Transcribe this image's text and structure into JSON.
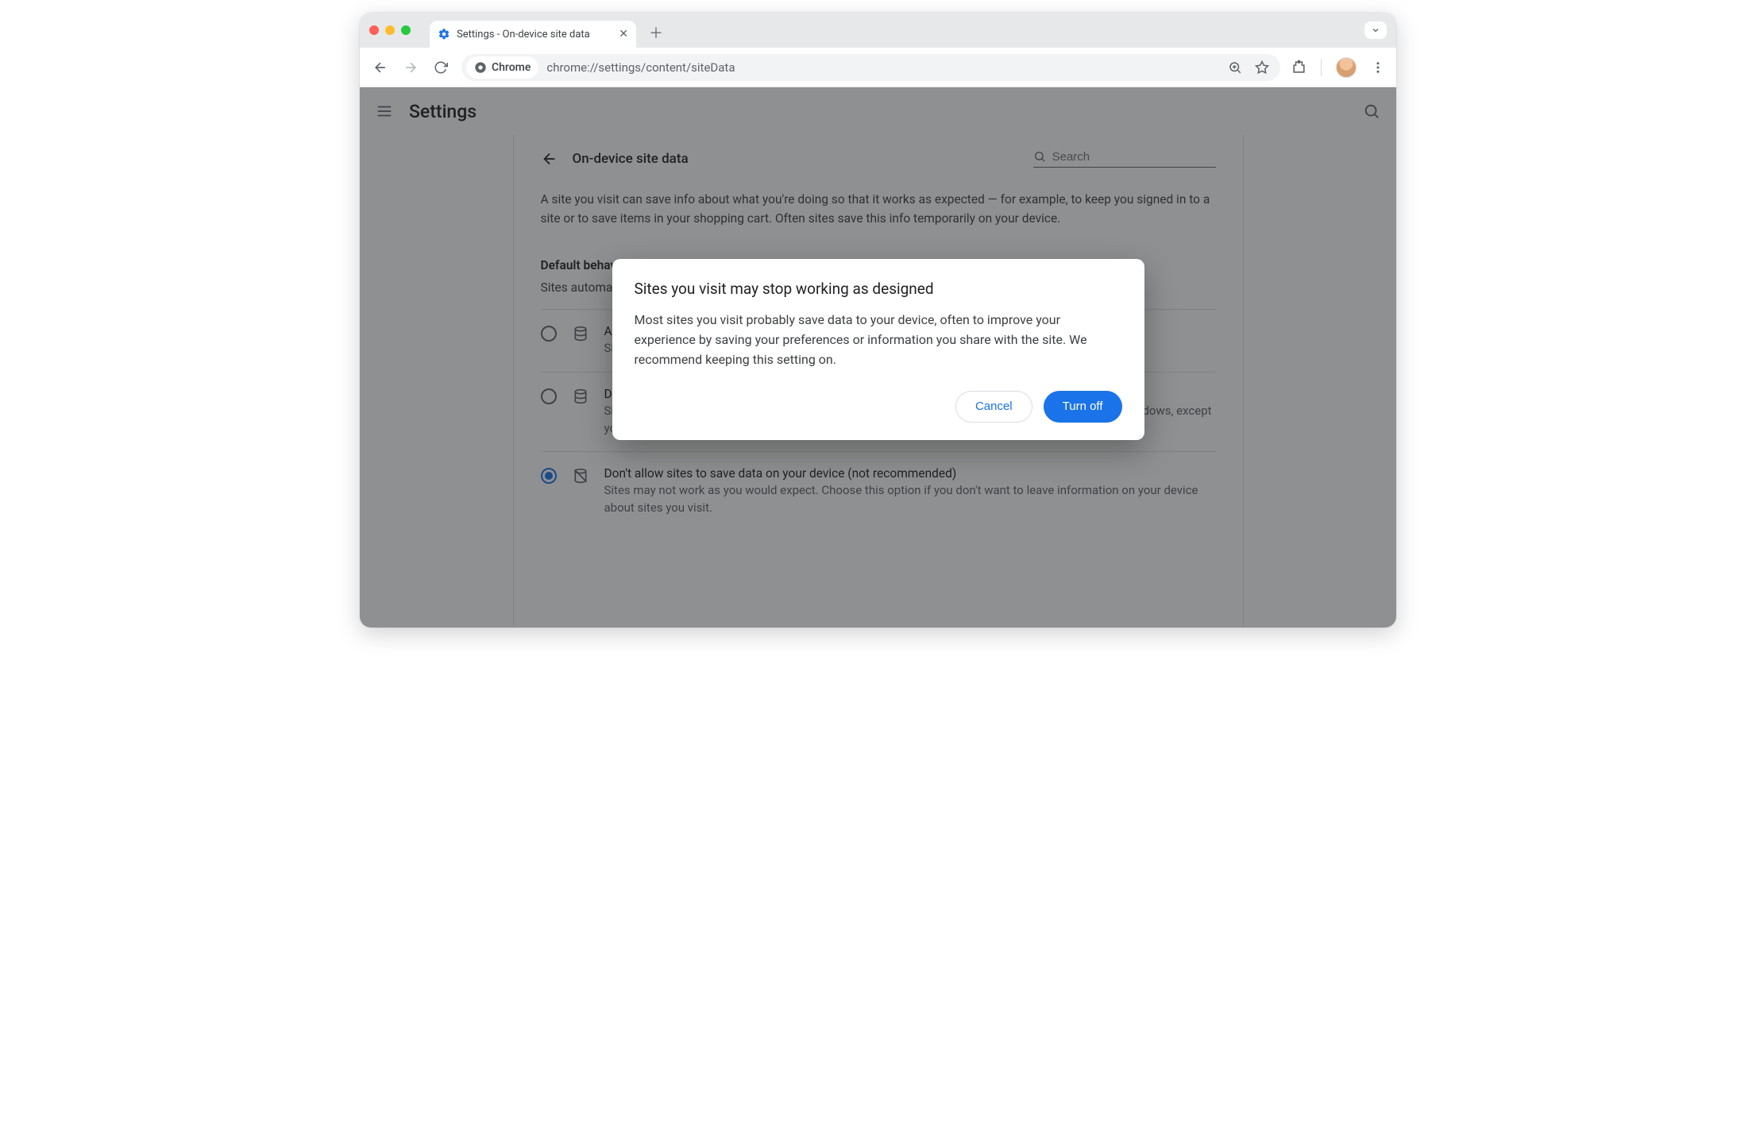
{
  "window": {
    "tab_title": "Settings - On-device site data",
    "url": "chrome://settings/content/siteData",
    "address_chip_label": "Chrome"
  },
  "header": {
    "app_title": "Settings"
  },
  "page": {
    "title": "On-device site data",
    "search_placeholder": "Search",
    "description": "A site you visit can save info about what you're doing so that it works as expected — for example, to keep you signed in to a site or to save items in your shopping cart. Often sites save this info temporarily on your device.",
    "section_heading": "Default behavior",
    "section_subtext": "Sites automatically follow this setting when you visit them",
    "options": [
      {
        "title": "Allow sites to save data on your device (recommended)",
        "subtitle": "Sites will work as expected.",
        "selected": false
      },
      {
        "title": "Delete data sites have saved to your device when you close all windows",
        "subtitle": "Sites will probably work as expected. You'll be signed out of most sites when you close all Chrome windows, except your Google Account if you're signed in to Chrome.",
        "selected": false
      },
      {
        "title": "Don't allow sites to save data on your device (not recommended)",
        "subtitle": "Sites may not work as you would expect. Choose this option if you don't want to leave information on your device about sites you visit.",
        "selected": true
      }
    ]
  },
  "dialog": {
    "title": "Sites you visit may stop working as designed",
    "body": "Most sites you visit probably save data to your device, often to improve your experience by saving your preferences or information you share with the site. We recommend keeping this setting on.",
    "cancel_label": "Cancel",
    "confirm_label": "Turn off"
  }
}
